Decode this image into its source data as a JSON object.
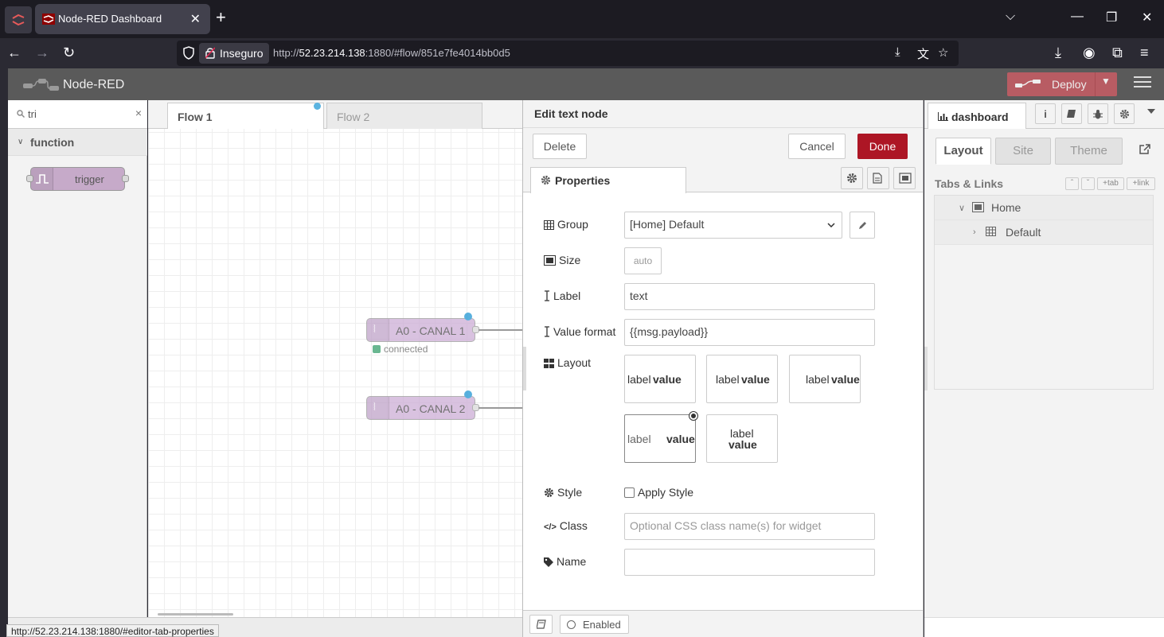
{
  "browser": {
    "tab_title": "Node-RED Dashboard",
    "tab_close": "✕",
    "new_tab": "+",
    "security_label": "Inseguro",
    "url_prefix": "http://",
    "url_host": "52.23.214.138",
    "url_rest": ":1880/#flow/851e7fe4014bb0d5",
    "status_url": "http://52.23.214.138:1880/#editor-tab-properties"
  },
  "header": {
    "brand": "Node-RED",
    "deploy_label": "Deploy"
  },
  "palette": {
    "search_value": "tri",
    "clear": "×",
    "category": "function",
    "nodes": [
      {
        "label": "trigger"
      }
    ]
  },
  "workspace": {
    "tabs": [
      {
        "label": "Flow 1"
      },
      {
        "label": "Flow 2"
      }
    ],
    "nodes": [
      {
        "label": "A0 - CANAL 1",
        "status": "connected"
      },
      {
        "label": "A0 - CANAL 2"
      }
    ]
  },
  "tray": {
    "title": "Edit text node",
    "delete_label": "Delete",
    "cancel_label": "Cancel",
    "done_label": "Done",
    "tab_properties": "Properties",
    "fields": {
      "group_label": "Group",
      "group_value": "[Home] Default",
      "size_label": "Size",
      "size_value": "auto",
      "label_label": "Label",
      "label_value": "text",
      "format_label": "Value format",
      "format_value": "{{msg.payload}}",
      "layout_label": "Layout",
      "style_label": "Style",
      "style_checkbox": "Apply Style",
      "style_checked": false,
      "class_label": "Class",
      "class_placeholder": "Optional CSS class name(s) for widget",
      "name_label": "Name",
      "name_value": ""
    },
    "layout_options": [
      {
        "label": "label",
        "value": "value"
      },
      {
        "label": "label",
        "value": "value"
      },
      {
        "label": "label",
        "value": "value"
      },
      {
        "label": "label",
        "value": "value",
        "selected": true
      },
      {
        "label": "label",
        "value": "value"
      }
    ],
    "footer_enabled": "Enabled"
  },
  "sidebar": {
    "tab_label": "dashboard",
    "inner_tabs": [
      "Layout",
      "Site",
      "Theme"
    ],
    "active_inner_tab": "Layout",
    "section_title": "Tabs & Links",
    "tab_button": "+tab",
    "link_button": "+link",
    "tree": [
      {
        "label": "Home",
        "type": "tab",
        "expanded": true
      },
      {
        "label": "Default",
        "type": "group",
        "expanded": false
      }
    ]
  },
  "colors": {
    "deploy": "#b85c63",
    "done": "#ad1625",
    "header": "#5a5a5a",
    "node_input": "#cdaed6",
    "trigger_node": "#c6aac9",
    "status_connected": "#6ab791"
  }
}
